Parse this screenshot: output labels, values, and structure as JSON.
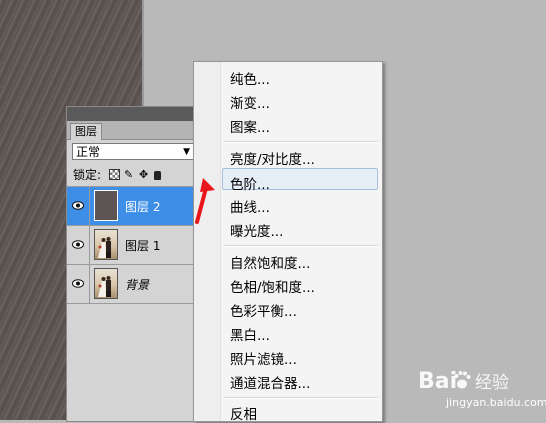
{
  "layers_panel": {
    "tab_label": "图层",
    "blend_mode": "正常",
    "lock_label": "锁定:",
    "layers": [
      {
        "name": "图层 2",
        "selected": true,
        "thumbnail": "gray-fill"
      },
      {
        "name": "图层 1",
        "selected": false,
        "thumbnail": "wedding-photo"
      },
      {
        "name": "背景",
        "selected": false,
        "thumbnail": "wedding-photo"
      }
    ]
  },
  "menu": {
    "items": [
      "纯色...",
      "渐变...",
      "图案...",
      "亮度/对比度...",
      "色阶...",
      "曲线...",
      "曝光度...",
      "自然饱和度...",
      "色相/饱和度...",
      "色彩平衡...",
      "黑白...",
      "照片滤镜...",
      "通道混合器...",
      "反相"
    ],
    "highlighted": "色阶..."
  },
  "annotation": {
    "type": "red-arrow",
    "color": "#e8161b"
  },
  "watermark": {
    "brand": "Bai",
    "brand_suffix": "经验",
    "url": "jingyan.baidu.com"
  }
}
